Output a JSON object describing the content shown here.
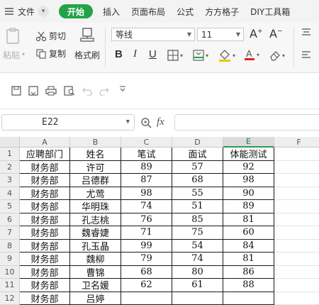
{
  "menubar": {
    "file": "文件",
    "tabs": [
      "开始",
      "插入",
      "页面布局",
      "公式",
      "方方格子",
      "DIY工具箱"
    ],
    "active_tab": "开始",
    "accent": "#22a34a"
  },
  "ribbon": {
    "paste": "粘贴",
    "cut": "剪切",
    "copy": "复制",
    "format_painter": "格式刷",
    "font_name": "等线",
    "font_size": "11",
    "bold": "B",
    "italic": "I",
    "underline": "U",
    "font_color_accent": "#e02020",
    "fill_color_accent": "#f0c400"
  },
  "formula_bar": {
    "cell_ref": "E22",
    "fx": "fx"
  },
  "sheet": {
    "columns": [
      "A",
      "B",
      "C",
      "D",
      "E",
      "F"
    ],
    "selected_column": "E",
    "row_numbers": [
      "1",
      "2",
      "3",
      "4",
      "5",
      "6",
      "7",
      "8",
      "9",
      "10",
      "11",
      "12"
    ],
    "rows": [
      [
        "应聘部门",
        "姓名",
        "笔试",
        "面试",
        "体能测试"
      ],
      [
        "财务部",
        "许可",
        "89",
        "57",
        "92"
      ],
      [
        "财务部",
        "吕德群",
        "87",
        "68",
        "98"
      ],
      [
        "财务部",
        "尤莺",
        "98",
        "55",
        "90"
      ],
      [
        "财务部",
        "华明珠",
        "74",
        "51",
        "89"
      ],
      [
        "财务部",
        "孔志桃",
        "76",
        "85",
        "81"
      ],
      [
        "财务部",
        "魏睿婕",
        "71",
        "75",
        "60"
      ],
      [
        "财务部",
        "孔玉晶",
        "99",
        "54",
        "84"
      ],
      [
        "财务部",
        "魏柳",
        "79",
        "74",
        "81"
      ],
      [
        "财务部",
        "曹锦",
        "68",
        "80",
        "86"
      ],
      [
        "财务部",
        "卫名媛",
        "62",
        "61",
        "88"
      ],
      [
        "财务部",
        "吕婷",
        "",
        "",
        ""
      ]
    ]
  }
}
